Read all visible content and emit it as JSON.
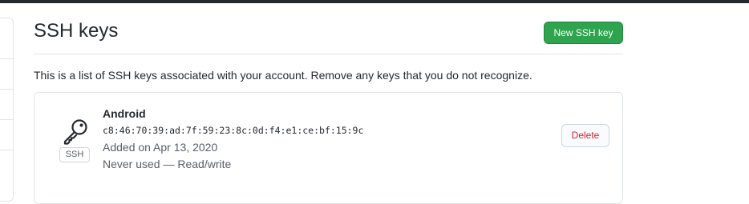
{
  "page": {
    "title": "SSH keys",
    "new_button_label": "New SSH key",
    "intro_text": "This is a list of SSH keys associated with your account. Remove any keys that you do not recognize."
  },
  "keys": [
    {
      "name": "Android",
      "fingerprint": "c8:46:70:39:ad:7f:59:23:8c:0d:f4:e1:ce:bf:15:9c",
      "added": "Added on Apr 13, 2020",
      "usage": "Never used — Read/write",
      "badge": "SSH",
      "icon": "key-icon",
      "delete_label": "Delete"
    }
  ],
  "colors": {
    "primary_button": "#2ea44f",
    "danger_text": "#cb2431",
    "border": "#e1e4e8",
    "topbar": "#24292e"
  }
}
